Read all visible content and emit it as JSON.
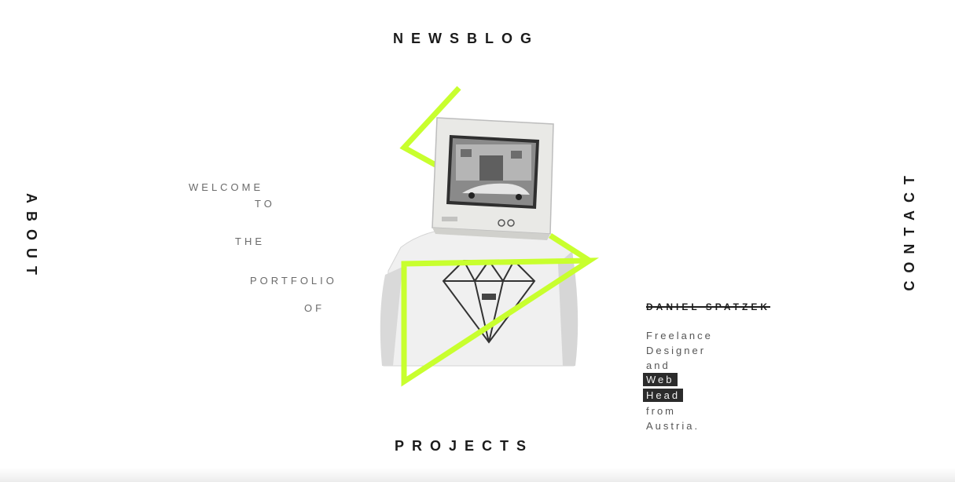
{
  "nav": {
    "top": "NEWSBLOG",
    "bottom": "PROJECTS",
    "left": "ABOUT",
    "right": "CONTACT"
  },
  "intro": {
    "welcome": "WELCOME",
    "to": "TO",
    "the": "THE",
    "portfolio": "PORTFOLIO",
    "of": "OF"
  },
  "person": {
    "name": "DANIEL SPATZEK",
    "bio": [
      "Freelance",
      "Designer",
      "and",
      "Web",
      "Head",
      "from",
      "Austria."
    ]
  },
  "colors": {
    "accent": "#c8ff2e",
    "text": "#1b1b1b",
    "highlight_bg": "#2b2b2b"
  }
}
